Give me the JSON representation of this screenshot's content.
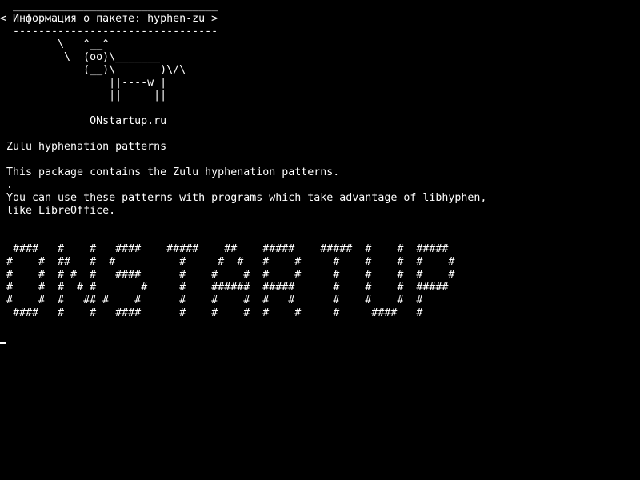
{
  "terminal": {
    "colors": {
      "background": "#000000",
      "foreground": "#ffffff"
    },
    "cowsay": {
      "border_top": " ________________________________",
      "message": "< Информация о пакете: hyphen-zu >",
      "border_bottom": " --------------------------------",
      "cow": [
        "        \\   ^__^",
        "         \\  (oo)\\_______",
        "            (__)\\       )\\/\\",
        "                ||----w |",
        "                ||     ||"
      ],
      "signature": "             ONstartup.ru"
    },
    "package": {
      "summary": "Zulu hyphenation patterns",
      "description_lines": [
        "This package contains the Zulu hyphenation patterns.",
        ".",
        "You can use these patterns with programs which take advantage of libhyphen,",
        "like LibreOffice."
      ]
    },
    "banner": {
      "lines": [
        " ####   #    #   ####    #####    ##    #####    #####  #    #  #####",
        "#    #  ##   #  #          #     #  #   #    #     #    #    #  #    #",
        "#    #  # #  #   ####      #    #    #  #    #     #    #    #  #    #",
        "#    #  #  # #       #     #    ######  #####      #    #    #  #####",
        "#    #  #   ## #    #      #    #    #  #   #      #    #    #  #",
        " ####   #    #   ####      #    #    #  #    #     #     ####   #"
      ]
    }
  }
}
